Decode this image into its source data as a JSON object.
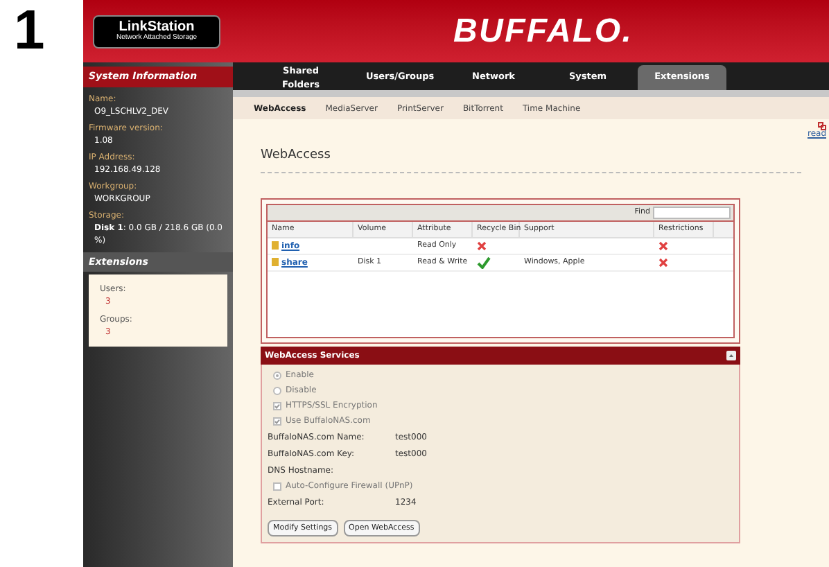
{
  "step": "1",
  "logo": {
    "title": "LinkStation",
    "subtitle": "Network Attached Storage"
  },
  "brand": "BUFFALO.",
  "sidebar": {
    "title": "System Information",
    "info": [
      {
        "label": "Name:",
        "value": "O9_LSCHLV2_DEV"
      },
      {
        "label": "Firmware version:",
        "value": "1.08"
      },
      {
        "label": "IP Address:",
        "value": "192.168.49.128"
      },
      {
        "label": "Workgroup:",
        "value": "WORKGROUP"
      },
      {
        "label": "Storage:",
        "value": "**Disk 1**: 0.0 GB / 218.6 GB (0.0 %)"
      }
    ],
    "extensions_title": "Extensions",
    "extensions": [
      {
        "label": "Users:",
        "value": "3"
      },
      {
        "label": "Groups:",
        "value": "3"
      }
    ]
  },
  "nav_tabs": [
    {
      "label": "Shared Folders",
      "selected": false
    },
    {
      "label": "Users/Groups",
      "selected": false
    },
    {
      "label": "Network",
      "selected": false
    },
    {
      "label": "System",
      "selected": false
    },
    {
      "label": "Extensions",
      "selected": true
    }
  ],
  "sub_tabs": [
    {
      "label": "WebAccess",
      "selected": true
    },
    {
      "label": "MediaServer",
      "selected": false
    },
    {
      "label": "PrintServer",
      "selected": false
    },
    {
      "label": "BitTorrent",
      "selected": false
    },
    {
      "label": "Time Machine",
      "selected": false
    }
  ],
  "read_link": "read",
  "page_title": "WebAccess",
  "table": {
    "find_label": "Find",
    "columns": [
      "Name",
      "Volume",
      "Attribute",
      "Recycle Bin",
      "Support",
      "Restrictions"
    ],
    "rows": [
      {
        "name": "info",
        "volume": "",
        "attribute": "Read Only",
        "recycle_bin": false,
        "support": "",
        "restrictions": false
      },
      {
        "name": "share",
        "volume": "Disk 1",
        "attribute": "Read & Write",
        "recycle_bin": true,
        "support": "Windows, Apple",
        "restrictions": false
      }
    ]
  },
  "services": {
    "title": "WebAccess Services",
    "items": [
      {
        "kind": "radio",
        "label": "Enable",
        "selected": true,
        "disabled": true
      },
      {
        "kind": "radio",
        "label": "Disable",
        "selected": false,
        "disabled": true
      },
      {
        "kind": "checkbox",
        "label": "HTTPS/SSL Encryption",
        "checked": true,
        "disabled": true
      },
      {
        "kind": "checkbox",
        "label": "Use BuffaloNAS.com",
        "checked": true,
        "disabled": true
      },
      {
        "kind": "field",
        "label": "BuffaloNAS.com Name:",
        "value": "test000"
      },
      {
        "kind": "field",
        "label": "BuffaloNAS.com Key:",
        "value": "test000"
      },
      {
        "kind": "field",
        "label": "DNS Hostname:",
        "value": ""
      },
      {
        "kind": "checkbox",
        "label": "Auto-Configure Firewall (UPnP)",
        "checked": false,
        "disabled": true
      },
      {
        "kind": "field",
        "label": "External Port:",
        "value": "1234"
      }
    ],
    "buttons": [
      "Modify Settings",
      "Open WebAccess"
    ]
  }
}
